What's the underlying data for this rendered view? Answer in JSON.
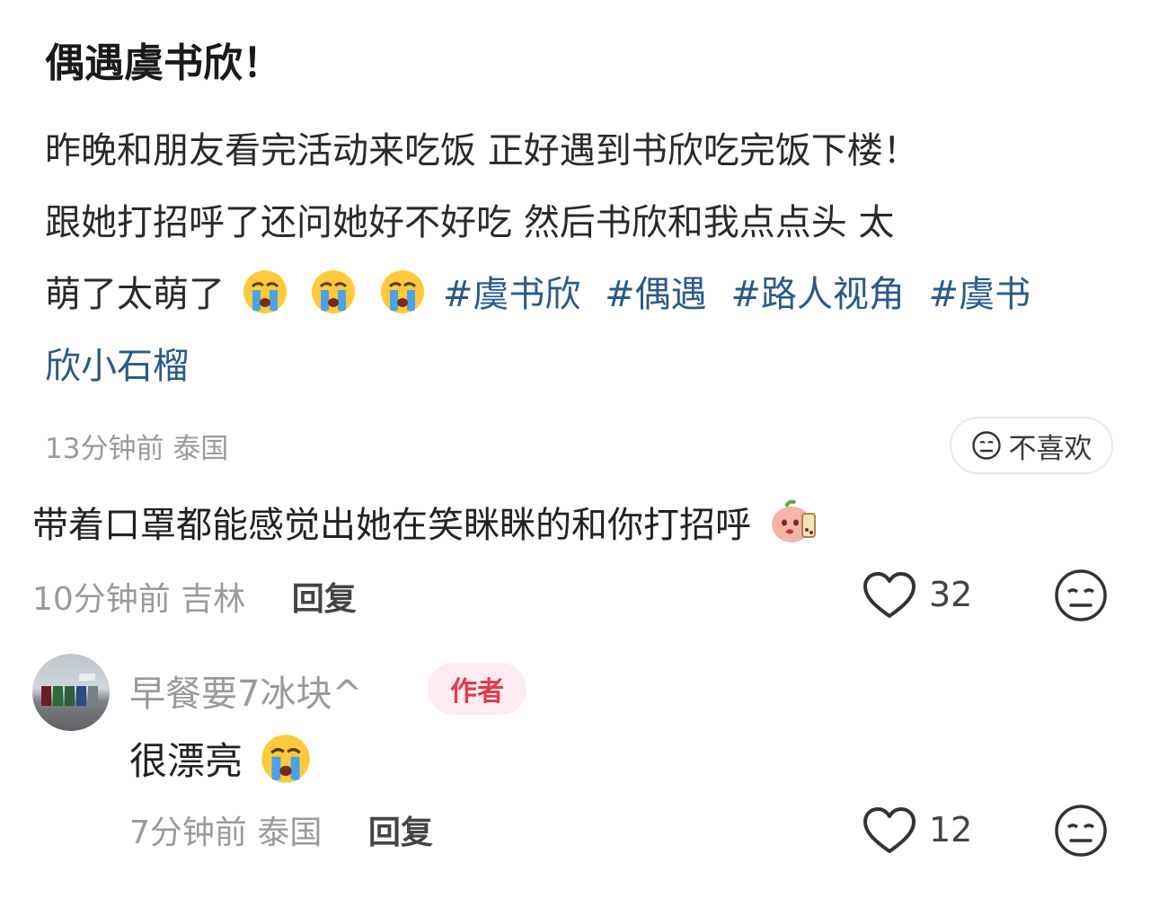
{
  "post": {
    "title": "偶遇虞书欣！",
    "body_line1": "昨晚和朋友看完活动来吃饭 正好遇到书欣吃完饭下楼！",
    "body_line2": "跟她打招呼了还问她好不好吃 然后书欣和我点点头 太",
    "body_line3_text": "萌了太萌了",
    "emoji": "crying-face-emoji",
    "hashtags": [
      "#虞书欣",
      "#偶遇",
      "#路人视角",
      "#虞书"
    ],
    "body_line4": "欣小石榴",
    "time": "13分钟前",
    "location": "泰国",
    "dislike_label": "不喜欢"
  },
  "comments": [
    {
      "text": "带着口罩都能感觉出她在笑眯眯的和你打招呼",
      "sticker": "peach-sticker-emoji",
      "time": "10分钟前",
      "location": "吉林",
      "reply_label": "回复",
      "likes": "32"
    },
    {
      "author": "早餐要7冰块^",
      "badge": "作者",
      "text": "很漂亮",
      "emoji": "crying-face-emoji",
      "time": "7分钟前",
      "location": "泰国",
      "reply_label": "回复",
      "likes": "12"
    }
  ],
  "colors": {
    "hashtag": "#2a5a8c",
    "badge_text": "#e33a54",
    "badge_bg": "#fdecef"
  }
}
